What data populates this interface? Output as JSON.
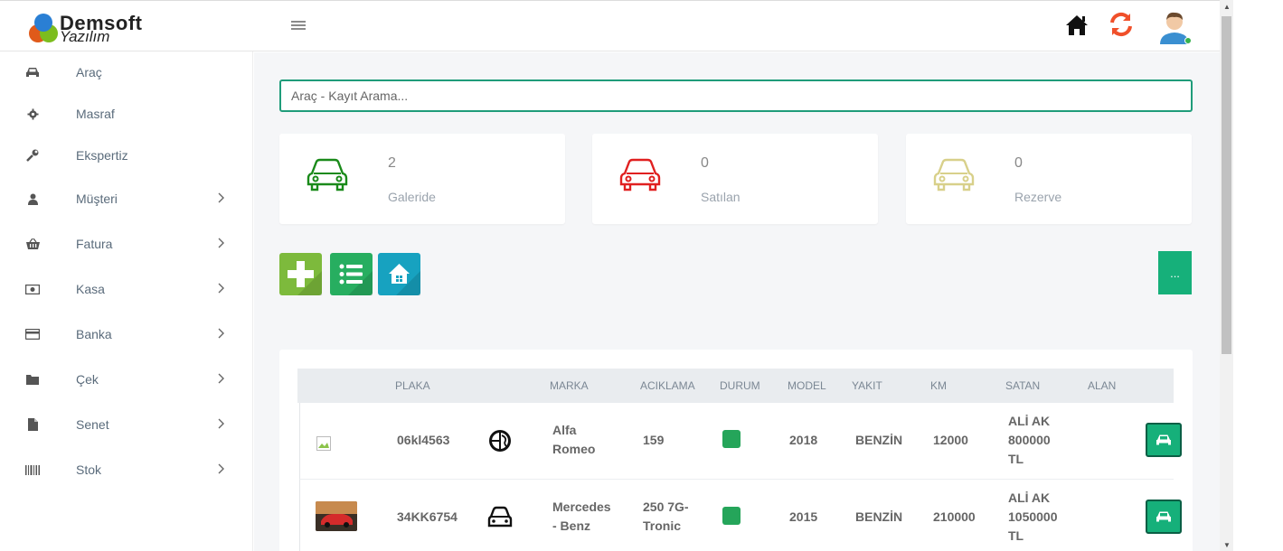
{
  "app": {
    "logo_line1": "Demsoft",
    "logo_line2": "Yazılım",
    "brand_color": "#16b07a"
  },
  "header": {
    "menu_icon": "hamburger-icon",
    "home_icon": "home-icon",
    "refresh_icon": "refresh-icon",
    "avatar_icon": "user-avatar-icon",
    "online_color": "#37b24d"
  },
  "sidebar": {
    "items": [
      {
        "label": "Araç",
        "icon": "car-icon",
        "has_submenu": false
      },
      {
        "label": "Masraf",
        "icon": "gear-icon",
        "has_submenu": false
      },
      {
        "label": "Ekspertiz",
        "icon": "wrench-icon",
        "has_submenu": false
      },
      {
        "label": "Müşteri",
        "icon": "user-icon",
        "has_submenu": true
      },
      {
        "label": "Fatura",
        "icon": "basket-icon",
        "has_submenu": true
      },
      {
        "label": "Kasa",
        "icon": "cash-icon",
        "has_submenu": true
      },
      {
        "label": "Banka",
        "icon": "credit-card-icon",
        "has_submenu": true
      },
      {
        "label": "Çek",
        "icon": "folder-icon",
        "has_submenu": true
      },
      {
        "label": "Senet",
        "icon": "file-icon",
        "has_submenu": true
      },
      {
        "label": "Stok",
        "icon": "barcode-icon",
        "has_submenu": true
      }
    ]
  },
  "search": {
    "placeholder": "Araç - Kayıt Arama...",
    "value": ""
  },
  "stats": [
    {
      "value": "2",
      "label": "Galeride",
      "color": "#1a8a1a"
    },
    {
      "value": "0",
      "label": "Satılan",
      "color": "#e02020"
    },
    {
      "value": "0",
      "label": "Rezerve",
      "color": "#d8d08a"
    }
  ],
  "actions": {
    "add_icon": "plus-icon",
    "list_icon": "list-icon",
    "home_icon": "home-icon",
    "more_label": "..."
  },
  "table": {
    "headers": [
      "PLAKA",
      "MARKA",
      "ACIKLAMA",
      "DURUM",
      "MODEL",
      "YAKIT",
      "KM",
      "SATAN",
      "ALAN"
    ],
    "rows": [
      {
        "plaka": "06kl4563",
        "brand_logo": "alfa-romeo-logo-icon",
        "marka_1": "Alfa",
        "marka_2": "Romeo",
        "aciklama_1": "159",
        "aciklama_2": "",
        "durum_color": "#25a55a",
        "model": "2018",
        "yakit": "BENZİN",
        "km": "12000",
        "satan_1": "ALİ AK",
        "satan_2": "800000",
        "satan_3": "TL",
        "alan": ""
      },
      {
        "plaka": "34KK6754",
        "brand_logo": "car-front-icon",
        "marka_1": "Mercedes",
        "marka_2": "- Benz",
        "aciklama_1": "250 7G-",
        "aciklama_2": "Tronic",
        "durum_color": "#25a55a",
        "model": "2015",
        "yakit": "BENZİN",
        "km": "210000",
        "satan_1": "ALİ AK",
        "satan_2": "1050000",
        "satan_3": "TL",
        "alan": ""
      }
    ]
  }
}
